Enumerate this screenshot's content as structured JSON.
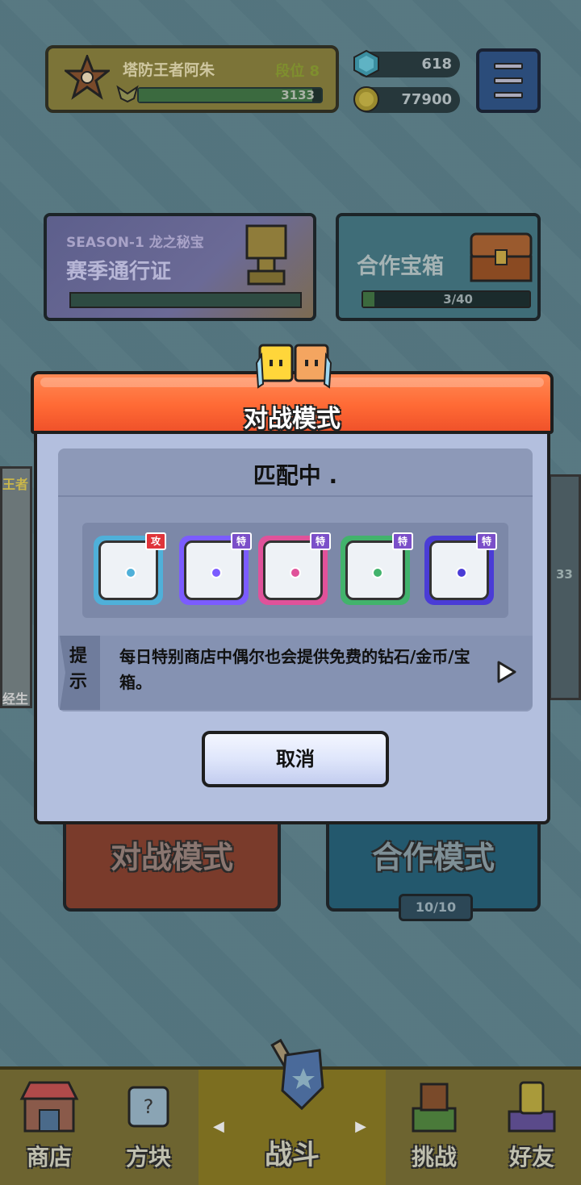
{
  "profile": {
    "player_name": "塔防王者阿朱",
    "rank_label": "段位 8",
    "trophies": "3133",
    "xp_progress": 0.95
  },
  "currency": {
    "gems": "618",
    "coins": "77900"
  },
  "season": {
    "tag": "SEASON-1 龙之秘宝",
    "title": "赛季通行证"
  },
  "coop_chest": {
    "title": "合作宝箱",
    "progress": "3/40"
  },
  "modes": {
    "battle_label": "对战模式",
    "coop_label": "合作模式",
    "coop_count": "10/10"
  },
  "side": {
    "left_top": "王者",
    "left_bottom": "经生",
    "right_value": "33"
  },
  "nav": {
    "items": [
      {
        "label": "商店"
      },
      {
        "label": "方块"
      },
      {
        "label": "战斗"
      },
      {
        "label": "挑战"
      },
      {
        "label": "好友"
      }
    ]
  },
  "modal": {
    "title": "对战模式",
    "status": "匹配中 .",
    "deck": [
      {
        "name": "vortex-dice",
        "badge": "攻",
        "badge_color": "#e0343a",
        "color": "#4fb0d9"
      },
      {
        "name": "rainbow-dice",
        "badge": "特",
        "badge_color": "#7b4fc9",
        "color": "#7b5cff"
      },
      {
        "name": "pink-dragon-dice",
        "badge": "特",
        "badge_color": "#7b4fc9",
        "color": "#e0529a"
      },
      {
        "name": "green-dragon-dice",
        "badge": "特",
        "badge_color": "#7b4fc9",
        "color": "#42b36c"
      },
      {
        "name": "hands-dice",
        "badge": "特",
        "badge_color": "#7b4fc9",
        "color": "#4a3cd6"
      }
    ],
    "tip_label": "提示",
    "tip_text": "每日特别商店中偶尔也会提供免费的钻石/金币/宝箱。",
    "cancel_label": "取消"
  },
  "colors": {
    "header_orange": "#ff6a35",
    "modal_body": "#b3bfde",
    "attack_badge": "#e0343a",
    "special_badge": "#7b4fc9"
  }
}
